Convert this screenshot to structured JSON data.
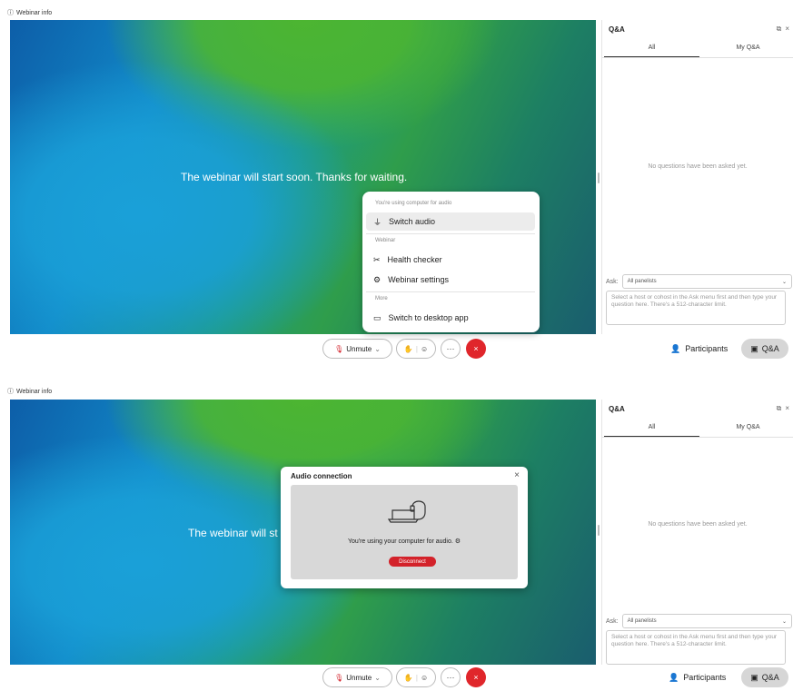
{
  "app": {
    "webinar_info": "Webinar info",
    "stage_message": "The webinar will start soon. Thanks for waiting.",
    "stage_message_truncated": "The webinar will st"
  },
  "qa_panel": {
    "title": "Q&A",
    "tabs": [
      "All",
      "My Q&A"
    ],
    "empty_message": "No questions have been asked yet.",
    "ask_label": "Ask:",
    "ask_selected": "All panelists",
    "ask_placeholder": "Select a host or cohost in the Ask menu first and then type your question here. There's a 512-character limit."
  },
  "controls": {
    "unmute": "Unmute",
    "participants": "Participants",
    "qa": "Q&A",
    "more": "···",
    "end": "×"
  },
  "more_menu": {
    "sections": {
      "audio_note": "You're using computer for audio",
      "webinar": "Webinar",
      "more": "More"
    },
    "items": {
      "switch_audio": "Switch audio",
      "health_checker": "Health checker",
      "webinar_settings": "Webinar settings",
      "switch_desktop": "Switch to desktop app"
    }
  },
  "audio_dialog": {
    "title": "Audio connection",
    "message": "You're using your computer for audio.",
    "disconnect": "Disconnect",
    "close": "×"
  },
  "colors": {
    "end_red": "#e0262b",
    "disconnect_red": "#d3222a",
    "qa_active_bg": "#d6d6d6"
  }
}
